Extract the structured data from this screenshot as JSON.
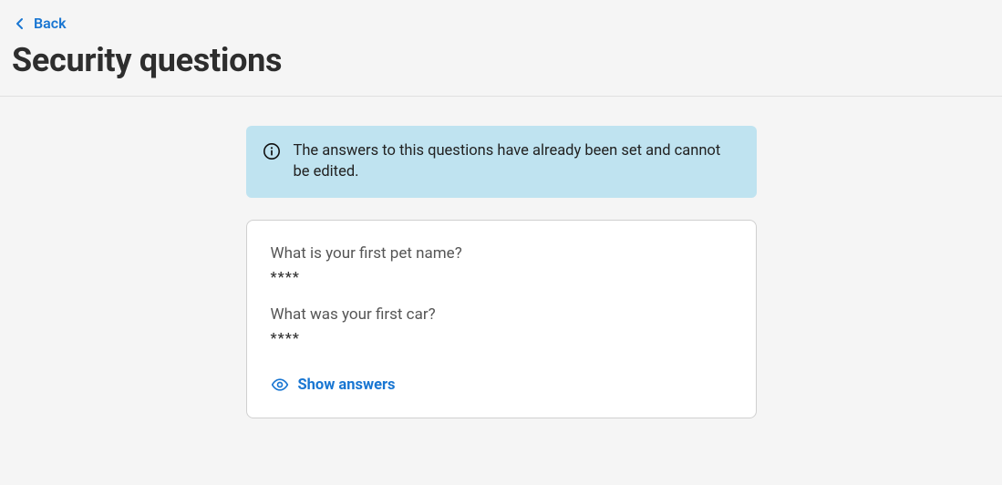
{
  "nav": {
    "back_label": "Back"
  },
  "page": {
    "title": "Security questions"
  },
  "banner": {
    "text": "The answers to this questions have already been set and cannot be edited."
  },
  "questions": [
    {
      "label": "What is your first pet name?",
      "masked_value": "****"
    },
    {
      "label": "What was your first car?",
      "masked_value": "****"
    }
  ],
  "actions": {
    "show_answers_label": "Show answers"
  }
}
